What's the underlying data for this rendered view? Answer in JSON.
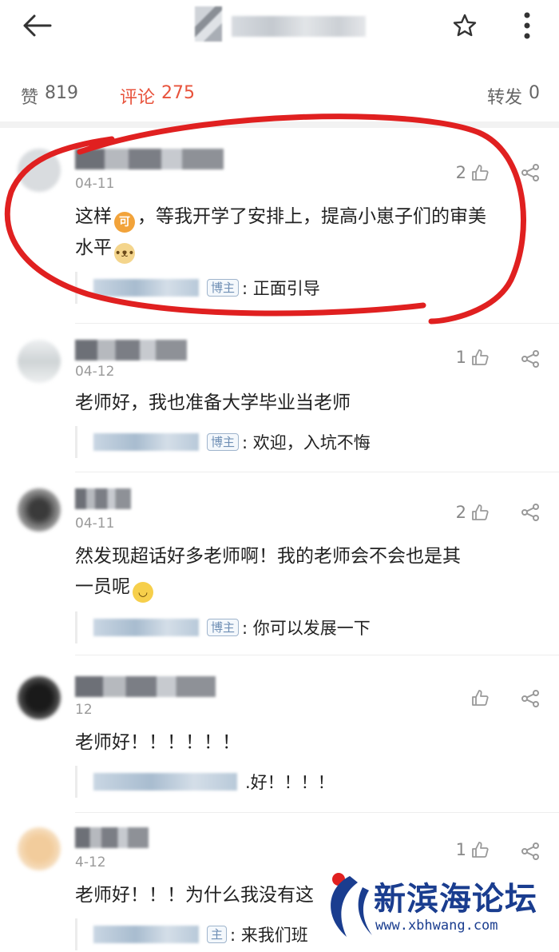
{
  "header": {
    "icons": [
      "back-icon",
      "star-icon",
      "more-vertical-icon"
    ]
  },
  "tabs": {
    "likes_label": "赞",
    "likes_count": "819",
    "comments_label": "评论",
    "comments_count": "275",
    "reposts_label": "转发",
    "reposts_count": "0"
  },
  "colors": {
    "accent": "#e8533c",
    "annotation": "#e02020",
    "watermark": "#1a3d8f"
  },
  "comments": [
    {
      "date": "04-11",
      "likes": "2",
      "text_line1": "这样",
      "text_line1b": "，等我开学了安排上，提高小崽子们的审美",
      "text_line2": "水平",
      "emoji_a": "可",
      "reply_badge": "博主",
      "reply_text": ": 正面引导"
    },
    {
      "date": "04-12",
      "likes": "1",
      "text_line1": "老师好，我也准备大学毕业当老师",
      "reply_badge": "博主",
      "reply_text": ": 欢迎，入坑不悔"
    },
    {
      "date": "04-11",
      "likes": "2",
      "text_line1": "然发现超话好多老师啊！我的老师会不会也是其",
      "text_line2": "一员呢",
      "reply_badge": "博主",
      "reply_text": ": 你可以发展一下"
    },
    {
      "date": "12",
      "likes": "",
      "text_line1": "老师好！！！！！！",
      "reply_text": ".好！！！！"
    },
    {
      "date": "4-12",
      "likes": "1",
      "text_line1": "老师好！！！为什么我没有这",
      "reply_badge": "主",
      "reply_text": ": 来我们班"
    }
  ],
  "watermark": {
    "name": "新滨海论坛",
    "url": "www.xbhwang.com"
  }
}
